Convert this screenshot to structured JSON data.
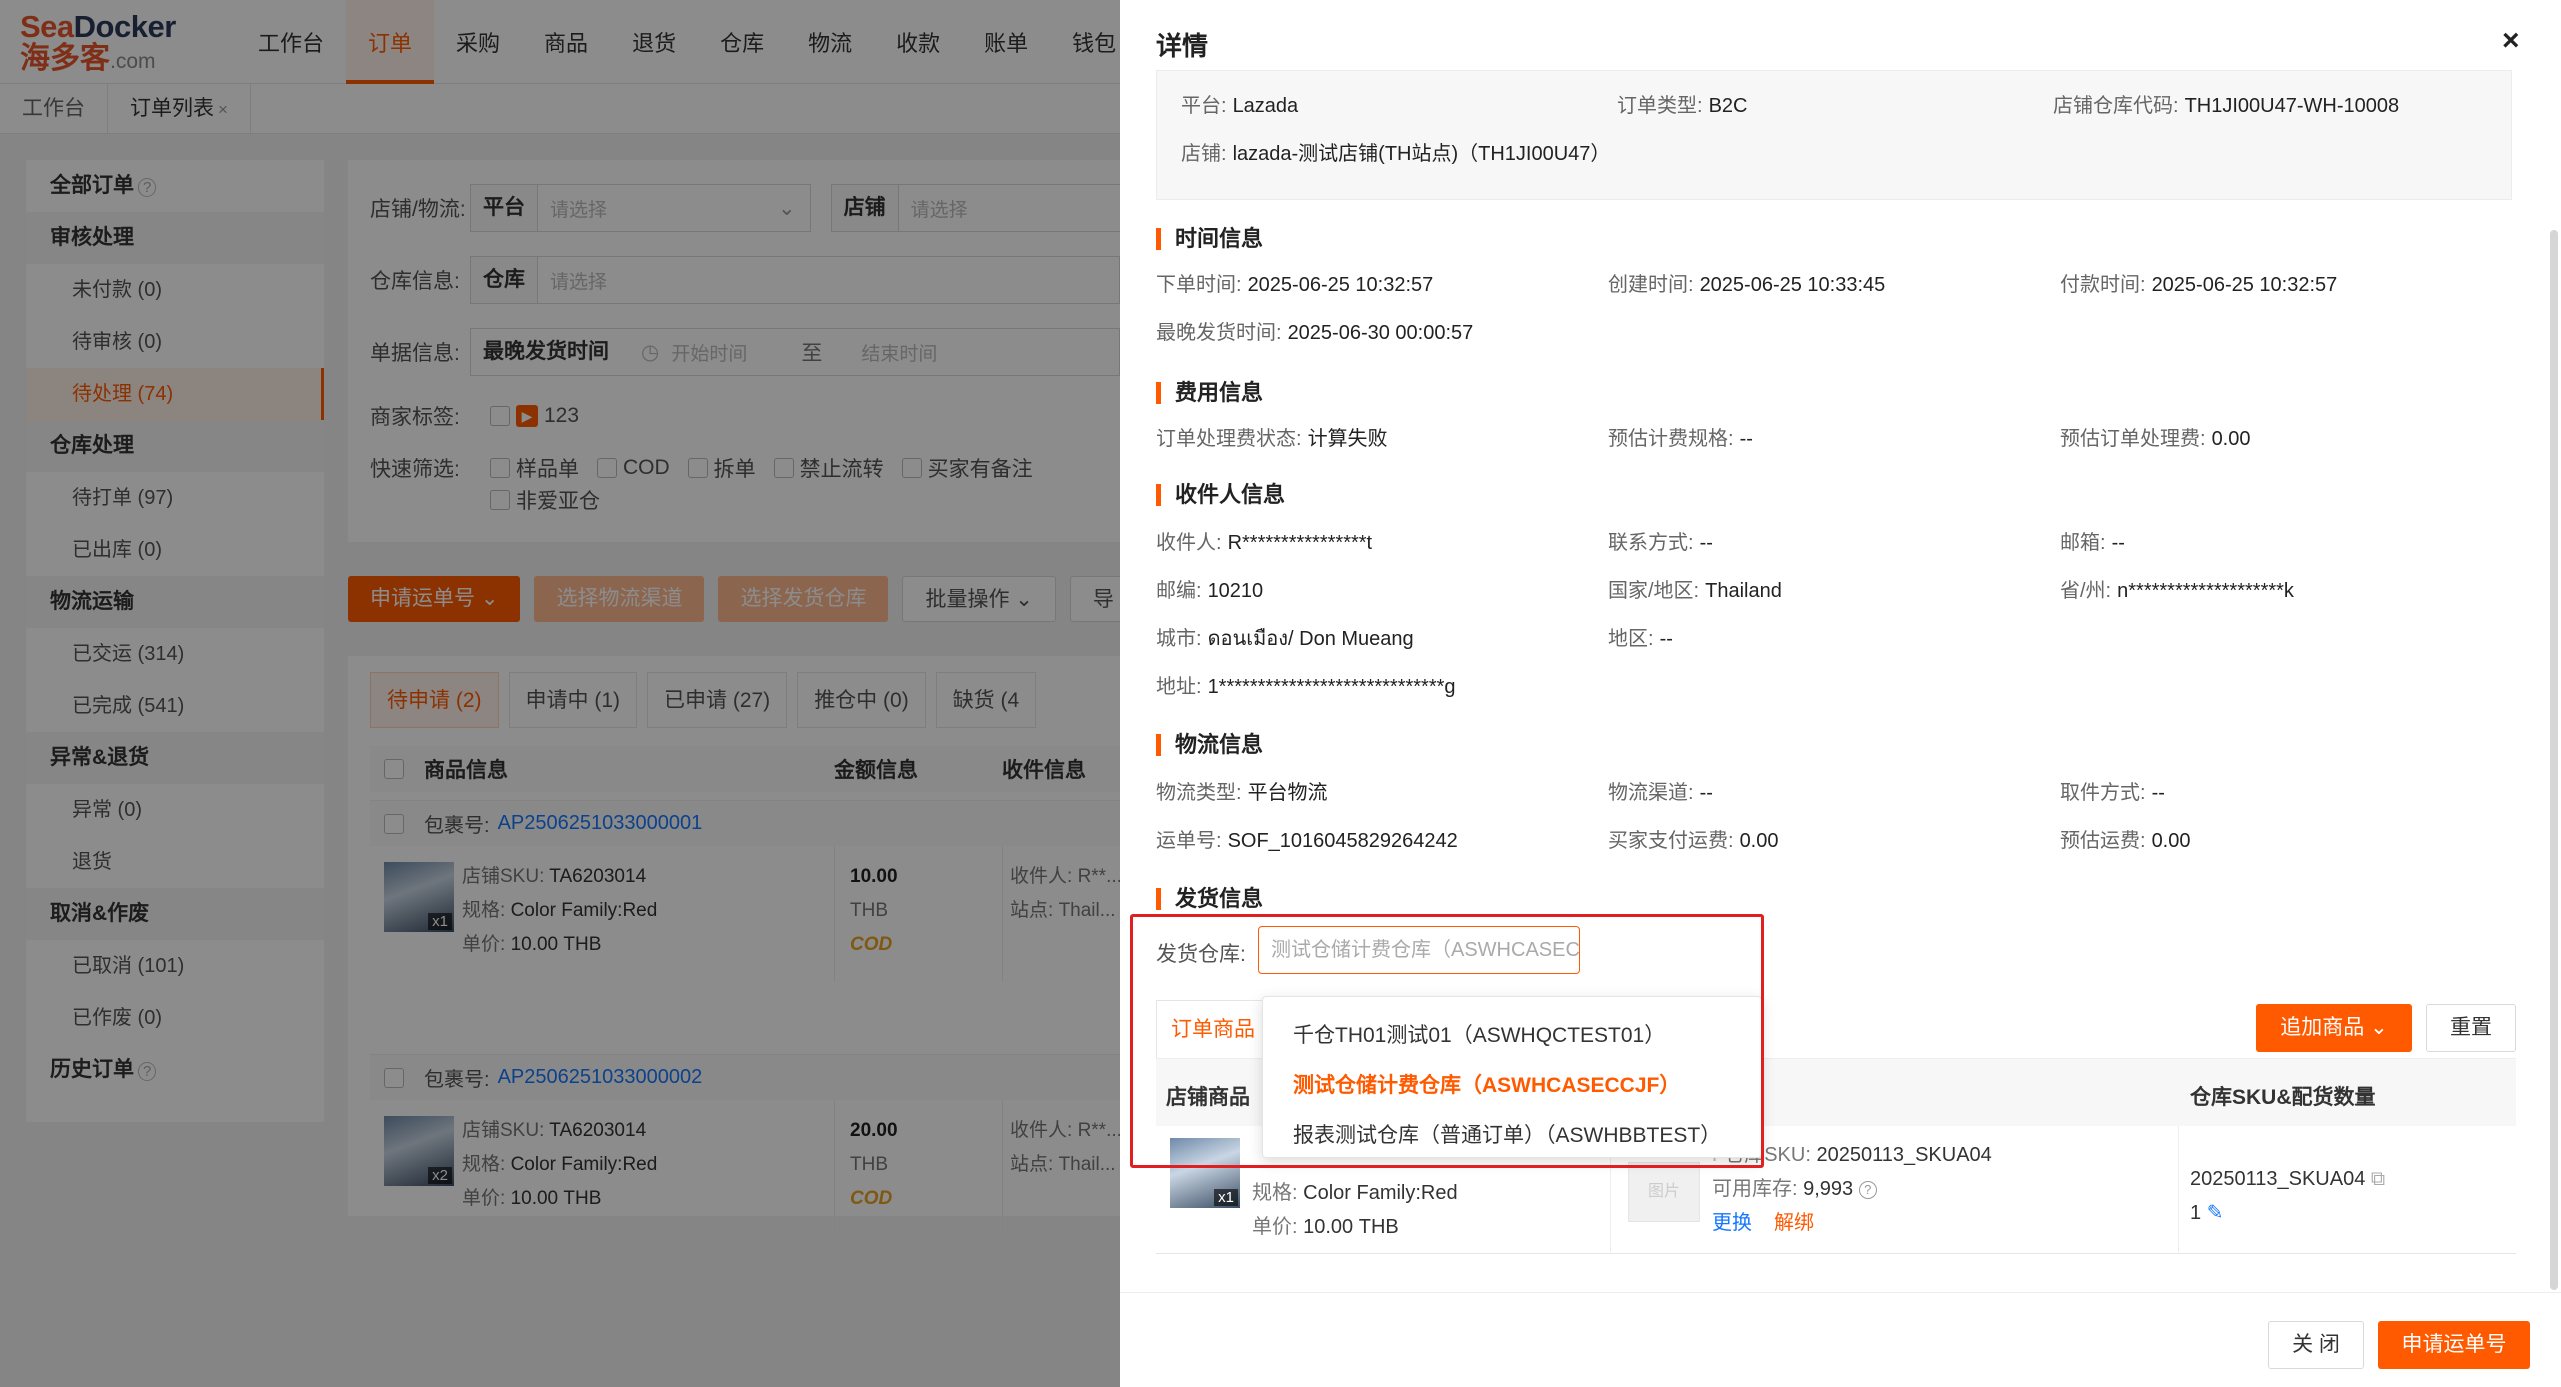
{
  "brand": {
    "name_en_1": "Sea",
    "name_en_2": "Docker",
    "name_cn": "海多客",
    "domain": ".com",
    "primary_color": "#ff5a00"
  },
  "nav": [
    "工作台",
    "订单",
    "采购",
    "商品",
    "退货",
    "仓库",
    "物流",
    "收款",
    "账单",
    "钱包"
  ],
  "nav_active": "订单",
  "tabs": [
    {
      "label": "工作台"
    },
    {
      "label": "订单列表",
      "close": "×"
    }
  ],
  "menu": {
    "all_orders": "全部订单",
    "groups": [
      {
        "title": "审核处理",
        "items": [
          "未付款 (0)",
          "待审核 (0)",
          "待处理 (74)"
        ]
      },
      {
        "title": "仓库处理",
        "items": [
          "待打单 (97)",
          "已出库 (0)"
        ]
      },
      {
        "title": "物流运输",
        "items": [
          "已交运 (314)",
          "已完成 (541)"
        ]
      },
      {
        "title": "异常&退货",
        "items": [
          "异常 (0)",
          "退货"
        ]
      },
      {
        "title": "取消&作废",
        "items": [
          "已取消 (101)",
          "已作废 (0)"
        ]
      }
    ],
    "history": "历史订单",
    "help": "?"
  },
  "filters": {
    "store_logistics": "店铺/物流:",
    "platform": "平台",
    "platform_ph": "请选择",
    "store": "店铺",
    "store_ph": "请选择",
    "warehouse_info": "仓库信息:",
    "warehouse": "仓库",
    "warehouse_ph": "请选择",
    "doc_info": "单据信息:",
    "latest_ship": "最晚发货时间",
    "start_ph": "开始时间",
    "to": "至",
    "end_ph": "结束时间",
    "merchant_tag": "商家标签:",
    "tag_value": "123",
    "quick": "快速筛选:",
    "quick_items": [
      "样品单",
      "COD",
      "拆单",
      "禁止流转",
      "买家有备注"
    ],
    "quick_items2": [
      "非爱亚仓"
    ]
  },
  "actions": [
    "申请运单号",
    "选择物流渠道",
    "选择发货仓库",
    "批量操作",
    "导"
  ],
  "subtabs": [
    "待申请 (2)",
    "申请中 (1)",
    "已申请 (27)",
    "推仓中 (0)",
    "缺货 (4"
  ],
  "table_headers": [
    "商品信息",
    "金额信息",
    "收件信息"
  ],
  "orders": [
    {
      "pkg_label": "包裹号:",
      "pkg_no": "AP2506251033000001",
      "sku_label": "店铺SKU:",
      "sku": "TA6203014",
      "spec_label": "规格:",
      "spec": "Color Family:Red",
      "price_label": "单价:",
      "price": "10.00 THB",
      "amount": "10.00",
      "currency": "THB",
      "cod": "COD",
      "receiver_label": "收件人:",
      "receiver": "R**...",
      "site_label": "站点:",
      "site": "Thail...",
      "qty": "x1"
    },
    {
      "pkg_label": "包裹号:",
      "pkg_no": "AP2506251033000002",
      "sku_label": "店铺SKU:",
      "sku": "TA6203014",
      "spec_label": "规格:",
      "spec": "Color Family:Red",
      "price_label": "单价:",
      "price": "10.00 THB",
      "amount": "20.00",
      "currency": "THB",
      "cod": "COD",
      "receiver_label": "收件人:",
      "receiver": "R**...",
      "site_label": "站点:",
      "site": "Thail...",
      "qty": "x2"
    }
  ],
  "drawer": {
    "title": "详情",
    "close": "×",
    "basic": {
      "platform_l": "平台:",
      "platform": "Lazada",
      "otype_l": "订单类型:",
      "otype": "B2C",
      "whcode_l": "店铺仓库代码:",
      "whcode": "TH1JI00U47-WH-10008",
      "store_l": "店铺:",
      "store": "lazada-测试店铺(TH站点)（TH1JI00U47）"
    },
    "time": {
      "title": "时间信息",
      "order_l": "下单时间:",
      "order": "2025-06-25 10:32:57",
      "create_l": "创建时间:",
      "create": "2025-06-25 10:33:45",
      "pay_l": "付款时间:",
      "pay": "2025-06-25 10:32:57",
      "latest_l": "最晚发货时间:",
      "latest": "2025-06-30 00:00:57"
    },
    "fee": {
      "title": "费用信息",
      "status_l": "订单处理费状态:",
      "status": "计算失败",
      "rule_l": "预估计费规格:",
      "rule": "--",
      "est_l": "预估订单处理费:",
      "est": "0.00"
    },
    "recv": {
      "title": "收件人信息",
      "name_l": "收件人:",
      "name": "R****************t",
      "contact_l": "联系方式:",
      "contact": "--",
      "email_l": "邮箱:",
      "email": "--",
      "zip_l": "邮编:",
      "zip": "10210",
      "country_l": "国家/地区:",
      "country": "Thailand",
      "prov_l": "省/州:",
      "prov": "n********************k",
      "city_l": "城市:",
      "city": "ดอนเมือง/ Don Mueang",
      "area_l": "地区:",
      "area": "--",
      "addr_l": "地址:",
      "addr": "1*****************************g"
    },
    "logi": {
      "title": "物流信息",
      "type_l": "物流类型:",
      "type": "平台物流",
      "channel_l": "物流渠道:",
      "channel": "--",
      "pick_l": "取件方式:",
      "pick": "--",
      "track_l": "运单号:",
      "track": "SOF_1016045829264242",
      "buyer_l": "买家支付运费:",
      "buyer": "0.00",
      "est_l": "预估运费:",
      "est": "0.00"
    },
    "ship": {
      "title": "发货信息",
      "wh_l": "发货仓库:",
      "wh_value": "测试仓储计费仓库（ASWHCASECCJF）"
    },
    "dropdown": [
      "千仓TH01测试01（ASWHQCTEST01）",
      "测试仓储计费仓库（ASWHCASECCJF）",
      "报表测试仓库（普通订单）（ASWHBBTEST）"
    ],
    "dropdown_selected": 1,
    "prod_tab": "订单商品",
    "add_btn": "追加商品",
    "reset_btn": "重置",
    "col_store_item": "店铺商品",
    "col_wh_sku": "仓库SKU&配货数量",
    "item": {
      "qty": "x1",
      "spec_l": "规格:",
      "spec": "Color Family:Red",
      "price_l": "单价:",
      "price": "10.00 THB",
      "thumb_text": "图片",
      "sku_l": "仓库SKU:",
      "sku_fragment": "F",
      "sku": "20250113_SKUA04",
      "stock_l": "可用库存:",
      "stock": "9,993",
      "replace": "更换",
      "unbind": "解绑",
      "wh_sku": "20250113_SKUA04",
      "wh_qty": "1"
    },
    "footer_close": "关 闭",
    "footer_apply": "申请运单号"
  }
}
